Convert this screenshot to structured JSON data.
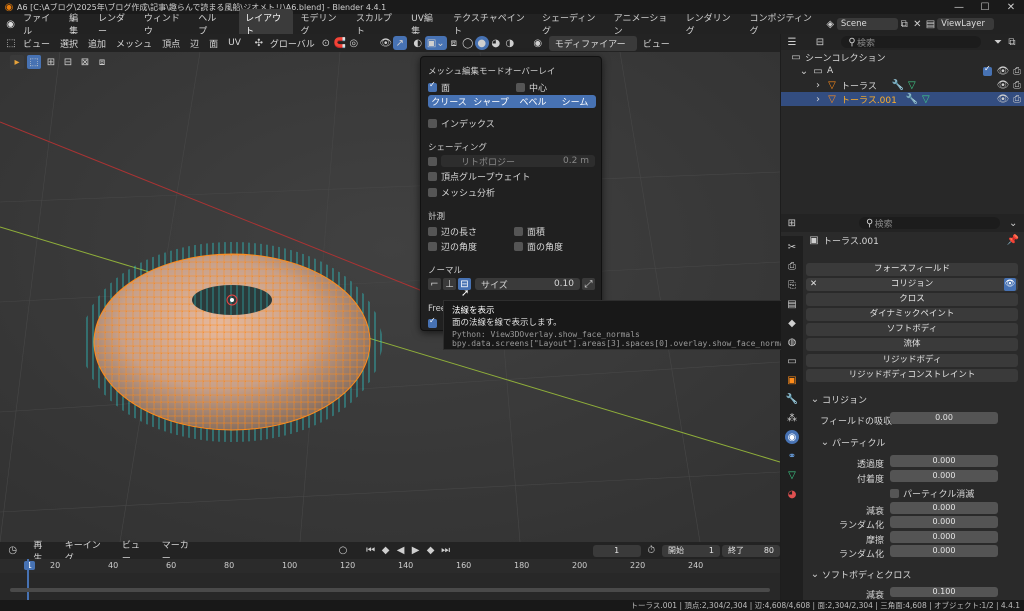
{
  "window": {
    "title": "A6 [C:\\Aブログ\\2025年\\ブログ作成\\記事\\趣らんで読まる風船\\ジオメトリ\\A6.blend] - Blender 4.4.1"
  },
  "menubar": {
    "menus": [
      "ファイル",
      "編集",
      "レンダー",
      "ウィンドウ",
      "ヘルプ"
    ],
    "workspaces": [
      "レイアウト",
      "モデリング",
      "スカルプト",
      "UV編集",
      "テクスチャペイント",
      "シェーディング",
      "アニメーション",
      "レンダリング",
      "コンポジティング"
    ],
    "active_workspace": "レイアウト",
    "scene": "Scene",
    "viewlayer": "ViewLayer"
  },
  "viewport_header": {
    "menus": [
      "ビュー",
      "選択",
      "追加",
      "メッシュ",
      "頂点",
      "辺",
      "面",
      "UV"
    ],
    "transform_orientation": "グローバル",
    "modifier_label": "モディファイアー",
    "view_label": "ビュー"
  },
  "overlay_popup": {
    "title": "メッシュ編集モードオーバーレイ",
    "face_label": "面",
    "center_label": "中心",
    "mark_buttons": [
      "クリース",
      "シャープ",
      "ベベル",
      "シーム"
    ],
    "index_label": "インデックス",
    "shading_title": "シェーディング",
    "retopology_label": "リトポロジー",
    "retopology_value": "0.2 m",
    "vertex_group_weight": "頂点グループウェイト",
    "mesh_analysis": "メッシュ分析",
    "measurement_title": "計測",
    "measure_items": [
      "辺の長さ",
      "面積",
      "辺の角度",
      "面の角度"
    ],
    "normals_title": "ノーマル",
    "size_label": "サイズ",
    "size_value": "0.10",
    "freestyle_label": "Free"
  },
  "tooltip": {
    "title": "法線を表示",
    "desc": "面の法線を線で表示します。",
    "python1": "Python: View3DOverlay.show_face_normals",
    "python2": "bpy.data.screens[\"Layout\"].areas[3].spaces[0].overlay.show_face_normals"
  },
  "outliner": {
    "search_placeholder": "検索",
    "collection": "シーンコレクション",
    "sub_collection": "A",
    "items": [
      {
        "name": "トーラス",
        "selected": false
      },
      {
        "name": "トーラス.001",
        "selected": true
      }
    ]
  },
  "properties": {
    "search_placeholder": "検索",
    "object_name": "トーラス.001",
    "physics_buttons": [
      "フォースフィールド",
      "コリジョン",
      "クロス",
      "ダイナミックペイント",
      "ソフトボディ",
      "流体",
      "リジッドボディ",
      "リジッドボディコンストレイント"
    ],
    "collision_panel": "コリジョン",
    "field_absorption_label": "フィールドの吸収",
    "field_absorption_value": "0.00",
    "particle_panel": "パーティクル",
    "permeability_label": "透過度",
    "permeability_value": "0.000",
    "stickiness_label": "付着度",
    "stickiness_value": "0.000",
    "kill_particles_label": "パーティクル消滅",
    "damping_label": "減衰",
    "damping_value": "0.000",
    "random_label": "ランダム化",
    "random_value": "0.000",
    "friction_label": "摩擦",
    "friction_value": "0.000",
    "random2_label": "ランダム化",
    "random2_value": "0.000",
    "softbody_panel": "ソフトボディとクロス",
    "softbody_damp_label": "減衰",
    "softbody_damp_value": "0.100"
  },
  "timeline": {
    "menus": [
      "再生",
      "キーイング",
      "ビュー",
      "マーカー"
    ],
    "current_frame": "1",
    "start_label": "開始",
    "start": "1",
    "end_label": "終了",
    "end": "80",
    "ticks": [
      "1",
      "20",
      "40",
      "60",
      "80",
      "100",
      "120",
      "140",
      "160",
      "180",
      "200",
      "220",
      "240"
    ]
  },
  "status_bar": {
    "text": "トーラス.001 | 頂点:2,304/2,304 | 辺:4,608/4,608 | 面:2,304/2,304 | 三角面:4,608 | オブジェクト:1/2 | 4.4.1"
  },
  "colors": {
    "accent": "#4772b3",
    "selected_orange": "#ff8c1a",
    "normal_cyan": "#2ad1d1",
    "viewport_bg": "#3b3b3b"
  }
}
